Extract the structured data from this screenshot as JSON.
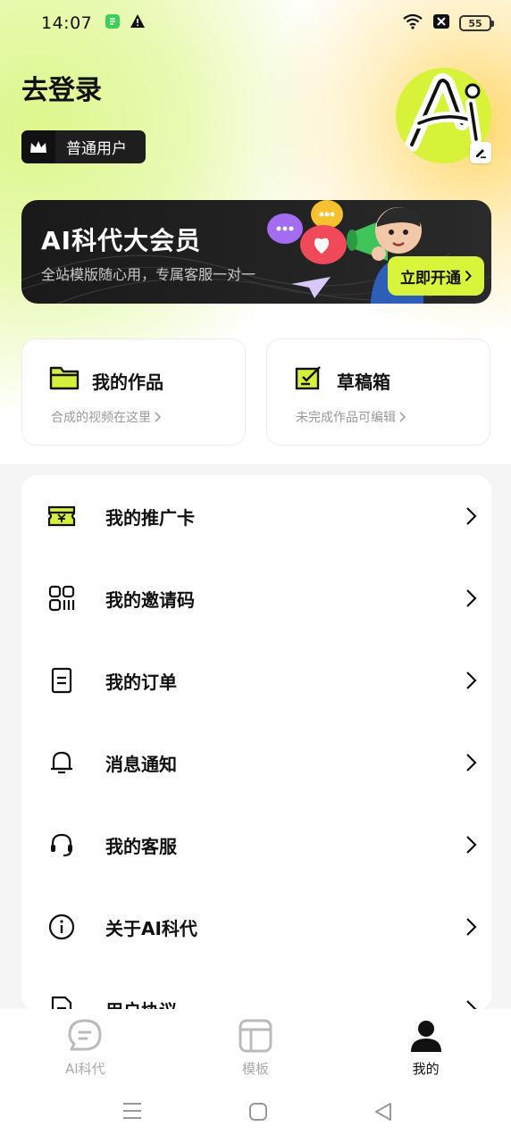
{
  "status_bar": {
    "time": "14:07",
    "battery": "55"
  },
  "header": {
    "login_title": "去登录",
    "user_level": "普通用户"
  },
  "vip_banner": {
    "title": "AI科代大会员",
    "subtitle": "全站模版随心用，专属客服一对一",
    "button": "立即开通"
  },
  "cards": [
    {
      "title": "我的作品",
      "subtitle": "合成的视频在这里",
      "icon": "folder-icon"
    },
    {
      "title": "草稿箱",
      "subtitle": "未完成作品可编辑",
      "icon": "draft-edit-icon"
    }
  ],
  "menu": [
    {
      "label": "我的推广卡",
      "icon": "promo-ticket-icon"
    },
    {
      "label": "我的邀请码",
      "icon": "qr-code-icon"
    },
    {
      "label": "我的订单",
      "icon": "order-document-icon"
    },
    {
      "label": "消息通知",
      "icon": "bell-icon"
    },
    {
      "label": "我的客服",
      "icon": "headset-icon"
    },
    {
      "label": "关于AI科代",
      "icon": "info-icon"
    },
    {
      "label": "用户协议",
      "icon": "agreement-document-icon"
    }
  ],
  "bottom_nav": [
    {
      "label": "AI科代",
      "icon": "chat-bubble-icon",
      "active": false
    },
    {
      "label": "模板",
      "icon": "template-layout-icon",
      "active": false
    },
    {
      "label": "我的",
      "icon": "person-icon",
      "active": true
    }
  ],
  "colors": {
    "accent": "#d9f53b",
    "dark": "#1e1e1e",
    "muted": "#999999"
  }
}
